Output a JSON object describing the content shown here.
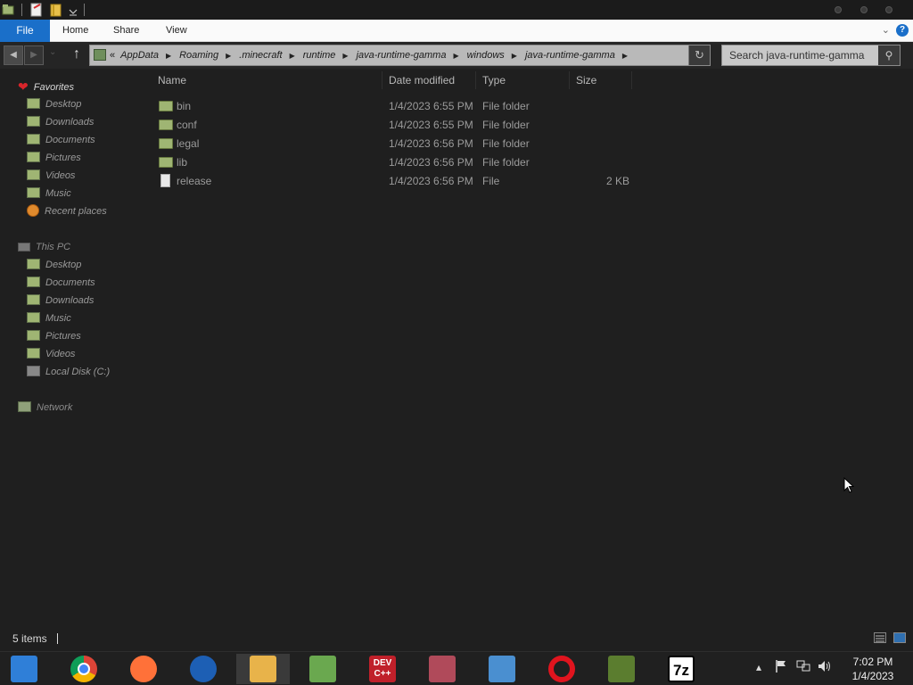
{
  "window": {
    "ribbon_tabs": {
      "file": "File",
      "home": "Home",
      "share": "Share",
      "view": "View"
    },
    "help_glyph": "?"
  },
  "address": {
    "overflow": "«",
    "crumbs": [
      "AppData",
      "Roaming",
      ".minecraft",
      "runtime",
      "java-runtime-gamma",
      "windows",
      "java-runtime-gamma"
    ],
    "search_placeholder": "Search java-runtime-gamma"
  },
  "nav": {
    "favorites": {
      "label": "Favorites",
      "items": [
        {
          "label": "Desktop",
          "icon": "desktop-icon"
        },
        {
          "label": "Downloads",
          "icon": "downloads-icon"
        },
        {
          "label": "Documents",
          "icon": "documents-icon"
        },
        {
          "label": "Pictures",
          "icon": "pictures-icon"
        },
        {
          "label": "Videos",
          "icon": "videos-icon"
        },
        {
          "label": "Music",
          "icon": "music-icon"
        },
        {
          "label": "Recent places",
          "icon": "recent-places-icon"
        }
      ]
    },
    "this_pc": {
      "label": "This PC",
      "items": [
        {
          "label": "Desktop",
          "icon": "desktop-icon"
        },
        {
          "label": "Documents",
          "icon": "documents-icon"
        },
        {
          "label": "Downloads",
          "icon": "downloads-icon"
        },
        {
          "label": "Music",
          "icon": "music-icon"
        },
        {
          "label": "Pictures",
          "icon": "pictures-icon"
        },
        {
          "label": "Videos",
          "icon": "videos-icon"
        },
        {
          "label": "Local Disk (C:)",
          "icon": "local-disk-icon"
        }
      ]
    },
    "network": {
      "label": "Network"
    }
  },
  "columns": {
    "name": "Name",
    "date": "Date modified",
    "type": "Type",
    "size": "Size"
  },
  "files": [
    {
      "name": "bin",
      "date": "1/4/2023 6:55 PM",
      "type": "File folder",
      "size": "",
      "kind": "folder"
    },
    {
      "name": "conf",
      "date": "1/4/2023 6:55 PM",
      "type": "File folder",
      "size": "",
      "kind": "folder"
    },
    {
      "name": "legal",
      "date": "1/4/2023 6:56 PM",
      "type": "File folder",
      "size": "",
      "kind": "folder"
    },
    {
      "name": "lib",
      "date": "1/4/2023 6:56 PM",
      "type": "File folder",
      "size": "",
      "kind": "folder"
    },
    {
      "name": "release",
      "date": "1/4/2023 6:56 PM",
      "type": "File",
      "size": "2 KB",
      "kind": "file"
    }
  ],
  "status": {
    "item_count": "5 items"
  },
  "taskbar": {
    "apps": [
      {
        "name": "control-panel-icon",
        "color": "#2f7fd8"
      },
      {
        "name": "chrome-icon",
        "color": "#db4437"
      },
      {
        "name": "firefox-icon",
        "color": "#ff7139"
      },
      {
        "name": "office-icon",
        "color": "#1d5fb4"
      },
      {
        "name": "file-explorer-icon",
        "color": "#e8b34a"
      },
      {
        "name": "network-users-icon",
        "color": "#6aa84f"
      },
      {
        "name": "devcpp-icon",
        "color": "#c0202a",
        "text": "DEV\nC++"
      },
      {
        "name": "snipping-tool-icon",
        "color": "#b04a5a"
      },
      {
        "name": "messenger-icon",
        "color": "#4a8fd0"
      },
      {
        "name": "opera-icon",
        "color": "#e0141e"
      },
      {
        "name": "minecraft-icon",
        "color": "#5b7d2f"
      },
      {
        "name": "7zip-icon",
        "color": "#ffffff",
        "text": "7z"
      }
    ],
    "clock": {
      "time": "7:02 PM",
      "date": "1/4/2023"
    }
  }
}
